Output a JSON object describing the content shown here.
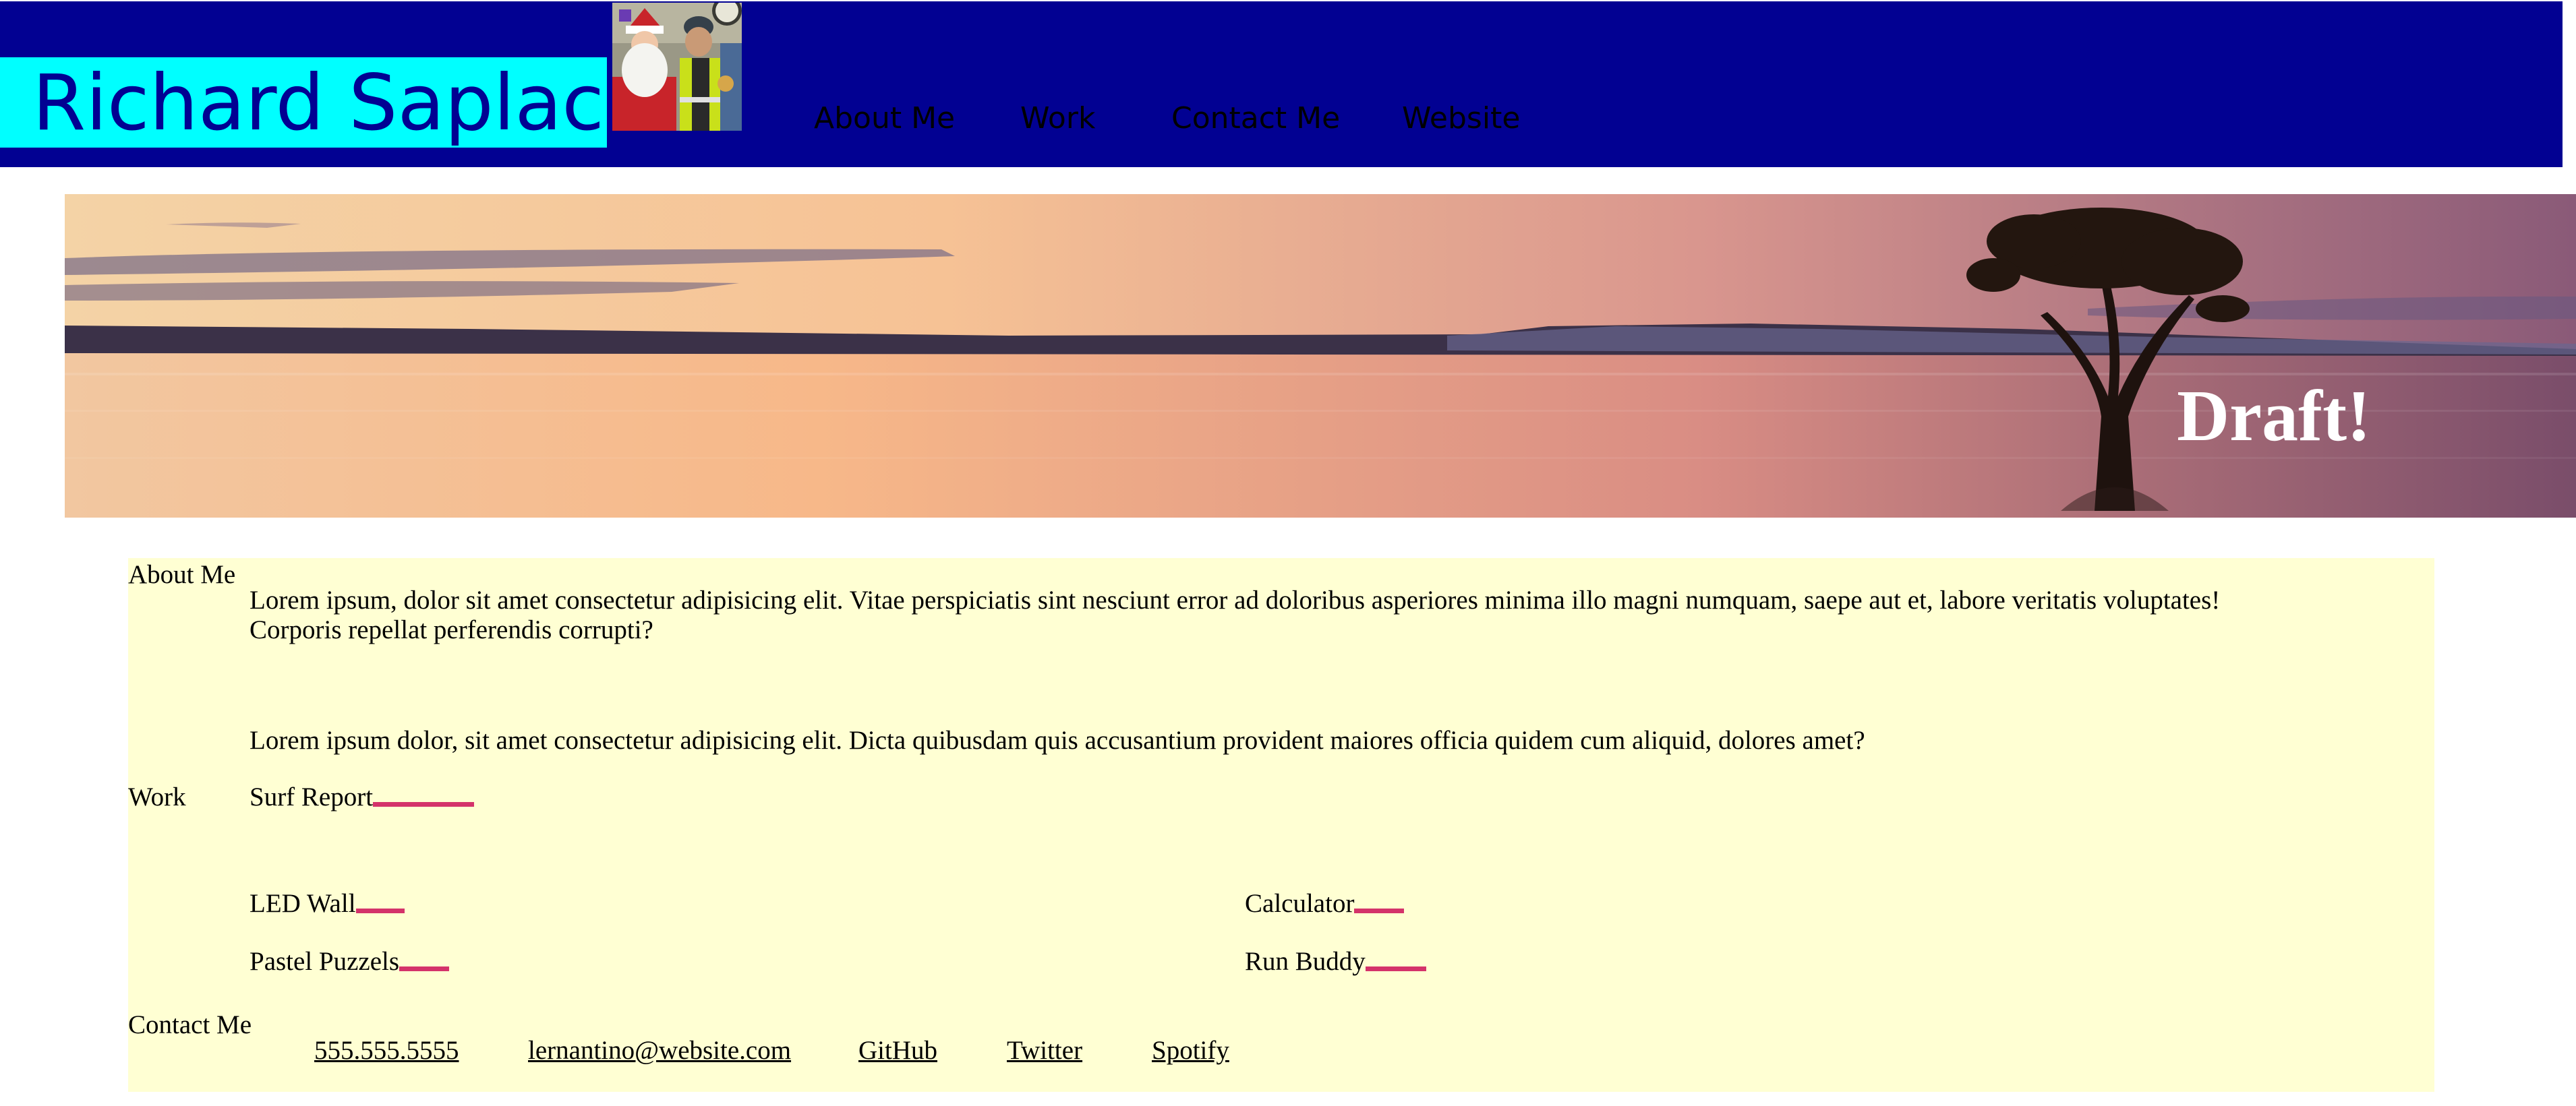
{
  "header": {
    "name": "Richard Saplaco",
    "nav": [
      {
        "label": "About Me"
      },
      {
        "label": "Work"
      },
      {
        "label": "Contact Me"
      },
      {
        "label": "Website"
      }
    ]
  },
  "hero": {
    "title": "Draft!"
  },
  "about": {
    "label": "About Me",
    "paragraph1_line1": "Lorem ipsum, dolor sit amet consectetur adipisicing elit. Vitae perspiciatis sint nesciunt error ad doloribus asperiores minima illo magni numquam, saepe aut et, labore veritatis voluptates!",
    "paragraph1_line2": "Corporis repellat perferendis corrupti?",
    "paragraph2": "Lorem ipsum dolor, sit amet consectetur adipisicing elit. Dicta quibusdam quis accusantium provident maiores officia quidem cum aliquid, dolores amet?"
  },
  "work": {
    "label": "Work",
    "projects": [
      {
        "title": "Surf Report"
      },
      {
        "title": "LED Wall"
      },
      {
        "title": "Calculator"
      },
      {
        "title": "Pastel Puzzels"
      },
      {
        "title": "Run Buddy"
      }
    ]
  },
  "contact": {
    "label": "Contact Me",
    "links": [
      {
        "text": "555.555.5555"
      },
      {
        "text": "lernantino@website.com"
      },
      {
        "text": "GitHub"
      },
      {
        "text": "Twitter"
      },
      {
        "text": "Spotify"
      }
    ]
  },
  "colors": {
    "header_bg": "#020192",
    "name_box_bg": "#00ffff",
    "content_bg": "#ffffd3",
    "accent": "#d4336a"
  }
}
